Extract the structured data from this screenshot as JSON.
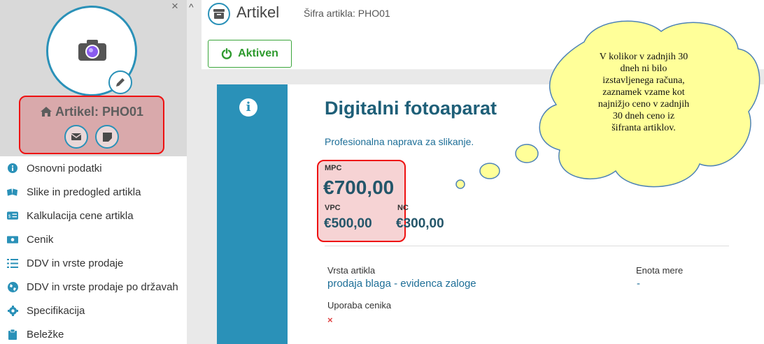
{
  "sidebar": {
    "close_glyph": "×",
    "scroll_glyph": "^",
    "title": "Artikel: PHO01",
    "menu": [
      {
        "label": "Osnovni podatki",
        "icon": "info-circle-icon"
      },
      {
        "label": "Slike in predogled artikla",
        "icon": "images-icon"
      },
      {
        "label": "Kalkulacija cene artikla",
        "icon": "price-tag-icon"
      },
      {
        "label": "Cenik",
        "icon": "money-icon"
      },
      {
        "label": "DDV in vrste prodaje",
        "icon": "list-icon"
      },
      {
        "label": "DDV in vrste prodaje po državah",
        "icon": "globe-icon"
      },
      {
        "label": "Specifikacija",
        "icon": "gear-icon"
      },
      {
        "label": "Beležke",
        "icon": "clipboard-icon"
      }
    ]
  },
  "header": {
    "title": "Artikel",
    "subtitle": "Šifra artikla: PHO01",
    "status_label": "Aktiven"
  },
  "product": {
    "name": "Digitalni fotoaparat",
    "description": "Profesionalna naprava za slikanje.",
    "mpc_label": "MPC",
    "mpc_value": "€700,00",
    "vpc_label": "VPC",
    "vpc_value": "€500,00",
    "nc_label": "NC",
    "nc_value": "€300,00",
    "type_label": "Vrsta artikla",
    "type_value": "prodaja blaga - evidenca zaloge",
    "unit_label": "Enota mere",
    "unit_value": "-",
    "pricelist_label": "Uporaba cenika",
    "pricelist_value": "×"
  },
  "callout": {
    "line1": "V kolikor v zadnjih 30",
    "line2": "dneh ni bilo",
    "line3": "izstavljenega računa,",
    "line4": "zaznamek vzame kot",
    "line5": "najnižjo ceno v zadnjih",
    "line6": "30 dneh ceno iz",
    "line7": "šifranta artiklov."
  },
  "colors": {
    "accent": "#2a91b8",
    "active_green": "#2e9a2e",
    "highlight_red": "#e11111",
    "cloud_fill": "#ffff99"
  }
}
